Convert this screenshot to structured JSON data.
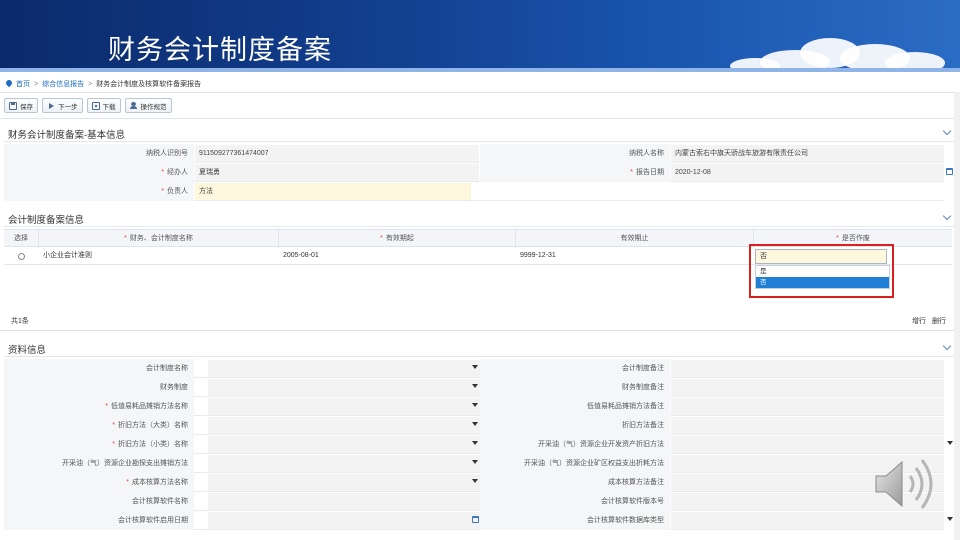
{
  "banner": {
    "title": "财务会计制度备案"
  },
  "breadcrumb": {
    "home": "首页",
    "sep1": ">",
    "level1": "综合信息报告",
    "sep2": ">",
    "current": "财务会计制度及核算软件备案报告"
  },
  "toolbar": {
    "save": "保存",
    "next": "下一步",
    "download": "下载",
    "guide": "操作规范"
  },
  "basic": {
    "title": "财务会计制度备案-基本信息",
    "taxpayer_id_label": "纳税人识别号",
    "taxpayer_id": "911509277361474007",
    "taxpayer_name_label": "纳税人名称",
    "taxpayer_name": "内蒙古索右中旗天骄战车旅游有限责任公司",
    "handler_label": "经办人",
    "handler": "夏瑞勇",
    "report_date_label": "报告日期",
    "report_date": "2020-12-08",
    "principal_label": "负责人",
    "principal": "方法"
  },
  "records": {
    "title": "会计制度备案信息",
    "headers": {
      "select": "选择",
      "name": "财务、会计制度名称",
      "start": "有效期起",
      "end": "有效期止",
      "abolish": "是否作废"
    },
    "row": {
      "name": "小企业会计准则",
      "start": "2005-08-01",
      "end": "9999-12-31",
      "abolish": "否"
    },
    "options": [
      "是",
      "否"
    ],
    "count": "共1条",
    "add": "增行",
    "delete": "删行"
  },
  "materials": {
    "title": "资料信息",
    "rows": [
      {
        "left": "会计制度名称",
        "left_req": false,
        "right": "会计制度备注"
      },
      {
        "left": "财务制度",
        "left_req": false,
        "right": "财务制度备注"
      },
      {
        "left": "低值易耗品摊销方法名称",
        "left_req": true,
        "right": "低值易耗品摊销方法备注"
      },
      {
        "left": "折旧方法（大类）名称",
        "left_req": true,
        "right": "折旧方法备注"
      },
      {
        "left": "折旧方法（小类）名称",
        "left_req": true,
        "right": "开采油（气）资源企业开发资产折旧方法"
      },
      {
        "left": "开采油（气）资源企业勘探支出摊销方法",
        "left_req": false,
        "right": "开采油（气）资源企业矿区权益支出折耗方法"
      },
      {
        "left": "成本核算方法名称",
        "left_req": true,
        "right": "成本核算方法备注"
      },
      {
        "left": "会计核算软件名称",
        "left_req": false,
        "right": "会计核算软件版本号"
      },
      {
        "left": "会计核算软件启用日期",
        "left_req": false,
        "right": "会计核算软件数据库类型"
      }
    ]
  }
}
